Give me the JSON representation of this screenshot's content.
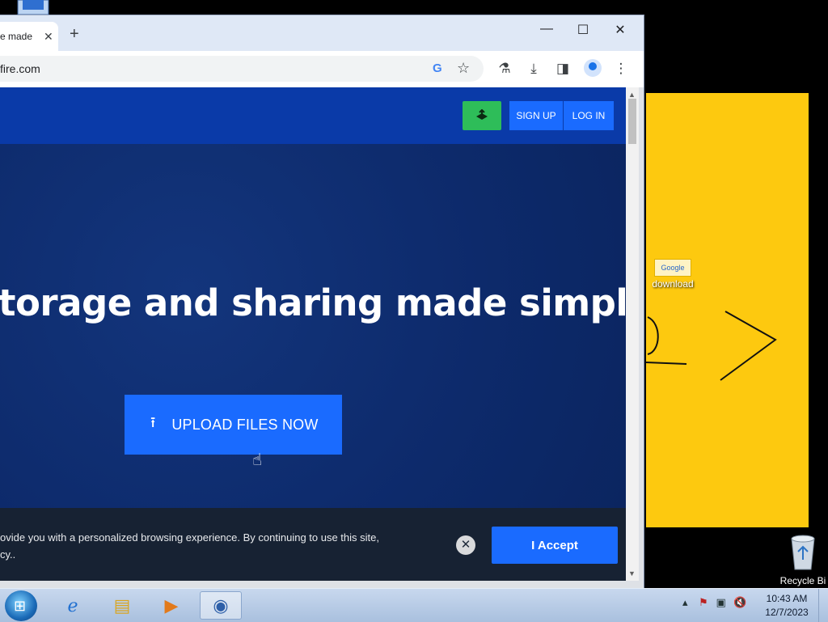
{
  "browser": {
    "tab_title": "e made",
    "tab_close": "✕",
    "new_tab": "+",
    "url": "fire.com",
    "window_controls": {
      "minimize": "—",
      "maximize": "☐",
      "close": "✕"
    }
  },
  "site": {
    "header": {
      "sign_up": "SIGN UP",
      "log_in": "LOG IN"
    },
    "hero": {
      "headline": "torage and sharing made simple",
      "upload_button": "UPLOAD FILES NOW"
    },
    "cookie_banner": {
      "text_line1": "ovide you with a personalized browsing experience. By continuing to use this site,",
      "text_line2": "cy..",
      "accept": "I Accept"
    }
  },
  "desktop": {
    "icons": [
      {
        "label": "download"
      },
      {
        "label": "Recycle Bi"
      }
    ]
  },
  "taskbar": {
    "clock_time": "10:43 AM",
    "clock_date": "12/7/2023"
  },
  "colors": {
    "site_header": "#0a3aa8",
    "primary_button": "#1a6bff",
    "green_button": "#2ebd59",
    "desktop_panel": "#fdc90f"
  }
}
